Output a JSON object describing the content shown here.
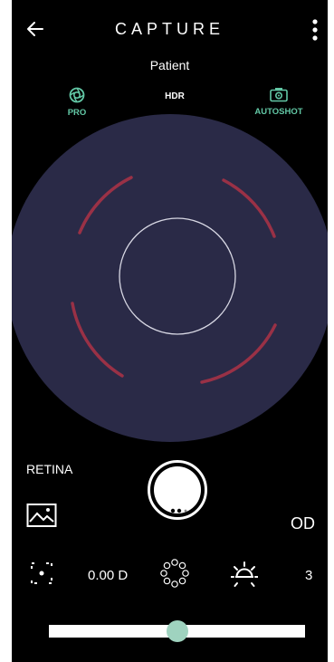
{
  "header": {
    "title": "CAPTURE",
    "back_icon": "arrow-left-icon",
    "menu_icon": "more-vertical-icon"
  },
  "patient_label": "Patient",
  "modes": {
    "pro": {
      "label": "PRO",
      "icon": "aperture-icon",
      "color": "#62c7a5"
    },
    "hdr": {
      "label": "HDR"
    },
    "autoshot": {
      "label": "AUTOSHOT",
      "icon": "camera-icon",
      "color": "#62c7a5"
    }
  },
  "viewer": {
    "background": "#2a2a47",
    "guide_color": "#b03a4a"
  },
  "capture": {
    "mode_label": "RETINA",
    "eye_label": "OD",
    "gallery_icon": "image-icon",
    "shutter_icon": "shutter-button"
  },
  "tools": {
    "focus_icon": "focus-target-icon",
    "diopter": "0.00 D",
    "led_icon": "led-ring-icon",
    "brightness_icon": "sun-icon",
    "brightness_level": "3"
  },
  "slider": {
    "value": 0.5,
    "thumb_color": "#9fd3bf"
  }
}
